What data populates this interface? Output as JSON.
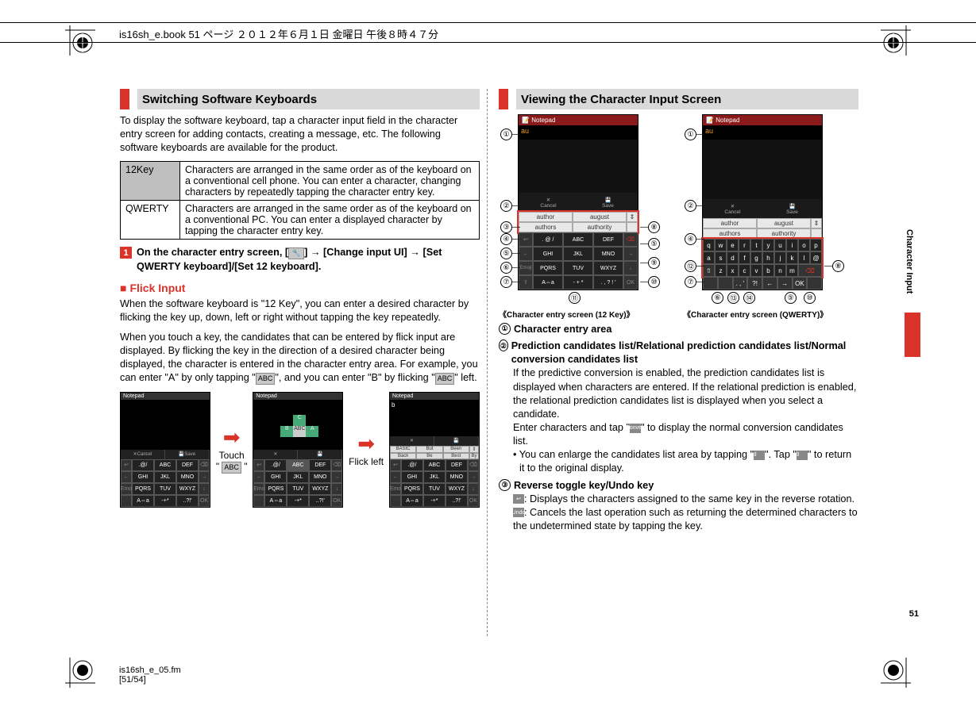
{
  "topbar": "is16sh_e.book  51 ページ  ２０１２年６月１日  金曜日  午後８時４７分",
  "footer_line1": "is16sh_e_05.fm",
  "footer_line2": "[51/54]",
  "page_number": "51",
  "side_tab": "Character Input",
  "left": {
    "section_title": "Switching Software Keyboards",
    "intro": "To display the software keyboard, tap a character input field in the character entry screen for adding contacts, creating a message, etc. The following software keyboards are available for the product.",
    "table": {
      "rows": [
        {
          "name": "12Key",
          "desc": "Characters are arranged in the same order as of the keyboard on a conventional cell phone. You can enter a character, changing characters by repeatedly tapping the character entry key."
        },
        {
          "name": "QWERTY",
          "desc": "Characters are arranged in the same order as of the keyboard on a conventional PC. You can enter a displayed character by tapping the character entry key."
        }
      ]
    },
    "step_text_a": "On the character entry screen, [",
    "step_text_b": "] → [Change input UI] → [Set QWERTY keyboard]/[Set 12 keyboard].",
    "settings_icon_name": "settings-icon",
    "flick_title": "Flick Input",
    "flick_p1": "When the software keyboard is \"12 Key\", you can enter a desired character by flicking the key up, down, left or right without tapping the key repeatedly.",
    "flick_p2_a": "When you touch a key, the candidates that can be entered by flick input are displayed. By flicking the key in the direction of a desired character being displayed, the character is entered in the character entry area. For example, you can enter \"A\" by only tapping \"",
    "flick_p2_b": "\", and you can enter \"B\" by flicking \"",
    "flick_p2_c": "\" left.",
    "abc_key_label": "ABC",
    "touch_label": "Touch",
    "flick_label": "Flick left",
    "mini": {
      "title": "Notepad",
      "cancel": "Cancel",
      "save": "Save",
      "keys": [
        "↩",
        ".@/",
        "ABC",
        "DEF",
        "⌫",
        "←",
        "GHI",
        "JKL",
        "MNO",
        "→",
        "Emo",
        "PQRS",
        "TUV",
        "WXYZ",
        "↓",
        "",
        "A⇔a",
        "-+*",
        "..?!'",
        "OK"
      ],
      "cand": [
        "BASIC",
        "But",
        "Been",
        "⇕",
        "Back",
        "Be",
        "Best",
        "By"
      ]
    }
  },
  "right": {
    "section_title": "Viewing the Character Input Screen",
    "caption_12": "《Character entry screen (12 Key)》",
    "caption_qw": "《Character entry screen (QWERTY)》",
    "screen": {
      "title": "Notepad",
      "input_text": "au",
      "cancel": "Cancel",
      "save": "Save",
      "cand": [
        "author",
        "august",
        "⇕",
        "authors",
        "authority"
      ],
      "keys12": [
        "↩",
        ". @ /",
        "ABC",
        "DEF",
        "⌫",
        "←",
        "GHI",
        "JKL",
        "MNO",
        "→",
        "Emoji",
        "PQRS",
        "TUV",
        "WXYZ",
        "↓",
        "⇧",
        "A⇔a",
        "- + *",
        ". , ? ! '",
        "OK"
      ],
      "qwerty": [
        "q",
        "w",
        "e",
        "r",
        "t",
        "y",
        "u",
        "i",
        "o",
        "p",
        "a",
        "s",
        "d",
        "f",
        "g",
        "h",
        "j",
        "k",
        "l",
        "@",
        "⇧",
        "z",
        "x",
        "c",
        "v",
        "b",
        "n",
        "m",
        "⌫",
        "",
        "",
        "",
        "",
        ". , '",
        "?!",
        "←",
        "→",
        "OK",
        ""
      ]
    },
    "callouts_12": [
      "①",
      "②",
      "③",
      "④",
      "⑤",
      "⑥",
      "⑦",
      "⑧",
      "⑤",
      "⑨",
      "⑩",
      "⑪"
    ],
    "callouts_qw": [
      "①",
      "②",
      "④",
      "⑫",
      "⑦",
      "⑧",
      "⑥",
      "⑬",
      "⑭",
      "⑤",
      "⑩"
    ],
    "items": {
      "1": {
        "num": "①",
        "title": "Character entry area"
      },
      "2": {
        "num": "②",
        "title": "Prediction candidates list/Relational prediction candidates list/Normal conversion candidates list",
        "body1": "If the predictive conversion is enabled, the prediction candidates list is displayed when characters are entered. If the relational prediction is enabled, the relational prediction candidates list is displayed when you select a candidate.",
        "body2a": "Enter characters and tap \"",
        "body2b": "\" to display the normal conversion candidates list.",
        "note_a": "• You can enlarge the candidates list area by tapping \"",
        "note_b": "\". Tap \"",
        "note_c": "\" to return it to the original display."
      },
      "3": {
        "num": "③",
        "title": "Reverse toggle key/Undo key",
        "rv": ": Displays the characters assigned to the same key in the reverse rotation.",
        "undo": ": Cancels the last operation such as returning the determined characters to the undetermined state by tapping the key."
      }
    },
    "icons": {
      "convert": "Convert",
      "expand": "⇕",
      "collapse": "⇕",
      "rev": "↩",
      "undo": "Undo"
    }
  }
}
